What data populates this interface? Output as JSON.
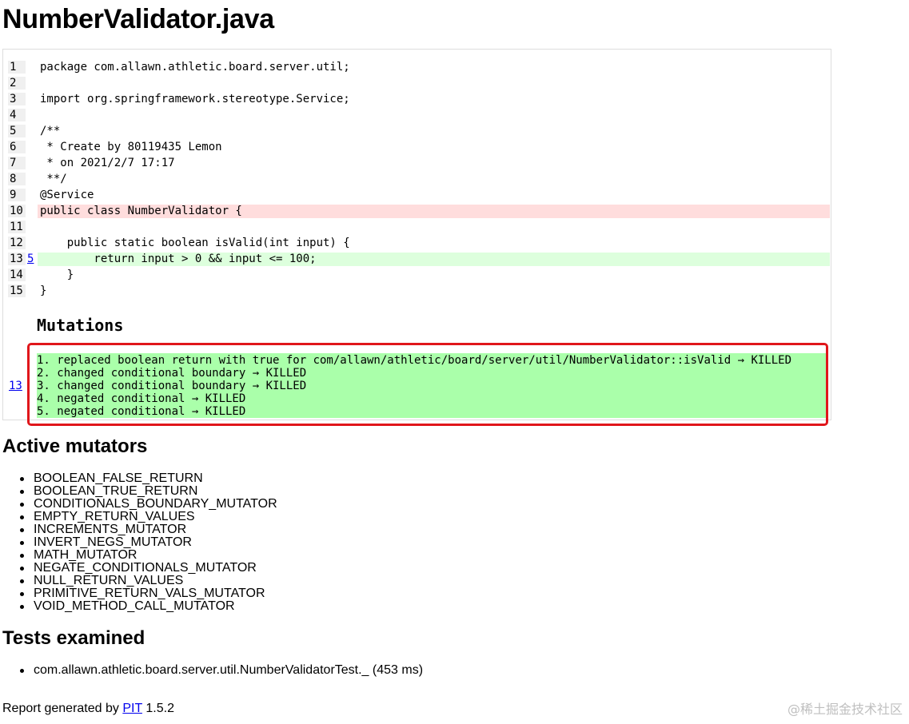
{
  "page": {
    "title": "NumberValidator.java"
  },
  "source": {
    "lines": [
      {
        "number": "1",
        "code": "package com.allawn.athletic.board.server.util;",
        "status": "none",
        "mutation_count": ""
      },
      {
        "number": "2",
        "code": "",
        "status": "none",
        "mutation_count": ""
      },
      {
        "number": "3",
        "code": "import org.springframework.stereotype.Service;",
        "status": "none",
        "mutation_count": ""
      },
      {
        "number": "4",
        "code": "",
        "status": "none",
        "mutation_count": ""
      },
      {
        "number": "5",
        "code": "/**",
        "status": "none",
        "mutation_count": ""
      },
      {
        "number": "6",
        "code": " * Create by 80119435 Lemon",
        "status": "none",
        "mutation_count": ""
      },
      {
        "number": "7",
        "code": " * on 2021/2/7 17:17",
        "status": "none",
        "mutation_count": ""
      },
      {
        "number": "8",
        "code": " **/",
        "status": "none",
        "mutation_count": ""
      },
      {
        "number": "9",
        "code": "@Service",
        "status": "none",
        "mutation_count": ""
      },
      {
        "number": "10",
        "code": "public class NumberValidator {",
        "status": "uncovered",
        "mutation_count": ""
      },
      {
        "number": "11",
        "code": "",
        "status": "none",
        "mutation_count": ""
      },
      {
        "number": "12",
        "code": "    public static boolean isValid(int input) {",
        "status": "none",
        "mutation_count": ""
      },
      {
        "number": "13",
        "code": "        return input > 0 && input <= 100;",
        "status": "killed",
        "mutation_count": "5"
      },
      {
        "number": "14",
        "code": "    }",
        "status": "none",
        "mutation_count": ""
      },
      {
        "number": "15",
        "code": "}",
        "status": "none",
        "mutation_count": ""
      }
    ]
  },
  "mutations": {
    "heading": "Mutations",
    "line_link": "13",
    "items": [
      "1. replaced boolean return with true for com/allawn/athletic/board/server/util/NumberValidator::isValid → KILLED",
      "2. changed conditional boundary → KILLED",
      "3. changed conditional boundary → KILLED",
      "4. negated conditional → KILLED",
      "5. negated conditional → KILLED"
    ]
  },
  "active_mutators": {
    "heading": "Active mutators",
    "items": [
      "BOOLEAN_FALSE_RETURN",
      "BOOLEAN_TRUE_RETURN",
      "CONDITIONALS_BOUNDARY_MUTATOR",
      "EMPTY_RETURN_VALUES",
      "INCREMENTS_MUTATOR",
      "INVERT_NEGS_MUTATOR",
      "MATH_MUTATOR",
      "NEGATE_CONDITIONALS_MUTATOR",
      "NULL_RETURN_VALUES",
      "PRIMITIVE_RETURN_VALS_MUTATOR",
      "VOID_METHOD_CALL_MUTATOR"
    ]
  },
  "tests_examined": {
    "heading": "Tests examined",
    "items": [
      "com.allawn.athletic.board.server.util.NumberValidatorTest._ (453 ms)"
    ]
  },
  "footer": {
    "prefix": "Report generated by ",
    "link": "PIT",
    "suffix": " 1.5.2"
  },
  "watermark": "@稀土掘金技术社区",
  "colors": {
    "uncovered_line": "#ffdddd",
    "killed_line": "#ddffdd",
    "mutation_block": "#aaffaa",
    "highlight_frame": "#e0161b",
    "link": "#0000ee"
  }
}
